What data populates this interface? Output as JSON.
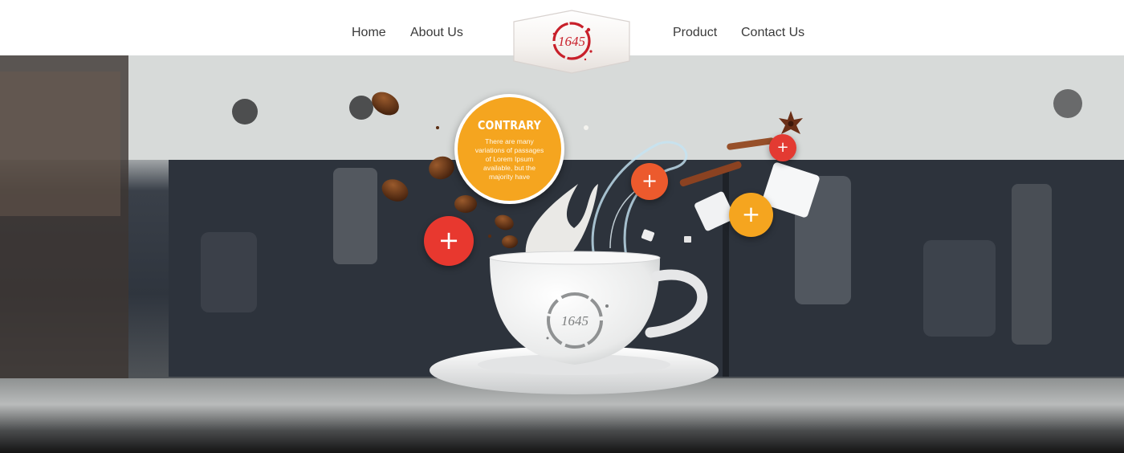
{
  "nav": {
    "left": [
      {
        "label": "Home"
      },
      {
        "label": "About Us"
      }
    ],
    "right": [
      {
        "label": "Product"
      },
      {
        "label": "Contact Us"
      }
    ],
    "logo_text": "1645"
  },
  "hero": {
    "cup_logo_text": "1645",
    "info_bubble": {
      "title": "CONTRARY",
      "text": "There are many variations of passages of Lorem Ipsum available, but the majority have"
    },
    "hotspots": [
      {
        "symbol": "+",
        "color": "#e8382f"
      },
      {
        "symbol": "+",
        "color": "#ec5a2d"
      },
      {
        "symbol": "+",
        "color": "#e33a32"
      },
      {
        "symbol": "+",
        "color": "#f5a51f"
      }
    ]
  },
  "colors": {
    "accent_orange": "#f5a51f",
    "accent_red": "#e8382f",
    "logo_red": "#c8202a",
    "nav_text": "#3a3a3a"
  }
}
